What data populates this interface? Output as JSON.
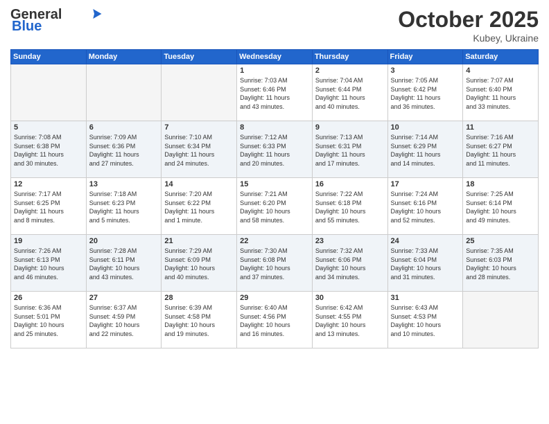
{
  "header": {
    "logo_general": "General",
    "logo_blue": "Blue",
    "month_title": "October 2025",
    "location": "Kubey, Ukraine"
  },
  "weekdays": [
    "Sunday",
    "Monday",
    "Tuesday",
    "Wednesday",
    "Thursday",
    "Friday",
    "Saturday"
  ],
  "weeks": [
    {
      "shade": false,
      "days": [
        {
          "num": "",
          "info": ""
        },
        {
          "num": "",
          "info": ""
        },
        {
          "num": "",
          "info": ""
        },
        {
          "num": "1",
          "info": "Sunrise: 7:03 AM\nSunset: 6:46 PM\nDaylight: 11 hours\nand 43 minutes."
        },
        {
          "num": "2",
          "info": "Sunrise: 7:04 AM\nSunset: 6:44 PM\nDaylight: 11 hours\nand 40 minutes."
        },
        {
          "num": "3",
          "info": "Sunrise: 7:05 AM\nSunset: 6:42 PM\nDaylight: 11 hours\nand 36 minutes."
        },
        {
          "num": "4",
          "info": "Sunrise: 7:07 AM\nSunset: 6:40 PM\nDaylight: 11 hours\nand 33 minutes."
        }
      ]
    },
    {
      "shade": true,
      "days": [
        {
          "num": "5",
          "info": "Sunrise: 7:08 AM\nSunset: 6:38 PM\nDaylight: 11 hours\nand 30 minutes."
        },
        {
          "num": "6",
          "info": "Sunrise: 7:09 AM\nSunset: 6:36 PM\nDaylight: 11 hours\nand 27 minutes."
        },
        {
          "num": "7",
          "info": "Sunrise: 7:10 AM\nSunset: 6:34 PM\nDaylight: 11 hours\nand 24 minutes."
        },
        {
          "num": "8",
          "info": "Sunrise: 7:12 AM\nSunset: 6:33 PM\nDaylight: 11 hours\nand 20 minutes."
        },
        {
          "num": "9",
          "info": "Sunrise: 7:13 AM\nSunset: 6:31 PM\nDaylight: 11 hours\nand 17 minutes."
        },
        {
          "num": "10",
          "info": "Sunrise: 7:14 AM\nSunset: 6:29 PM\nDaylight: 11 hours\nand 14 minutes."
        },
        {
          "num": "11",
          "info": "Sunrise: 7:16 AM\nSunset: 6:27 PM\nDaylight: 11 hours\nand 11 minutes."
        }
      ]
    },
    {
      "shade": false,
      "days": [
        {
          "num": "12",
          "info": "Sunrise: 7:17 AM\nSunset: 6:25 PM\nDaylight: 11 hours\nand 8 minutes."
        },
        {
          "num": "13",
          "info": "Sunrise: 7:18 AM\nSunset: 6:23 PM\nDaylight: 11 hours\nand 5 minutes."
        },
        {
          "num": "14",
          "info": "Sunrise: 7:20 AM\nSunset: 6:22 PM\nDaylight: 11 hours\nand 1 minute."
        },
        {
          "num": "15",
          "info": "Sunrise: 7:21 AM\nSunset: 6:20 PM\nDaylight: 10 hours\nand 58 minutes."
        },
        {
          "num": "16",
          "info": "Sunrise: 7:22 AM\nSunset: 6:18 PM\nDaylight: 10 hours\nand 55 minutes."
        },
        {
          "num": "17",
          "info": "Sunrise: 7:24 AM\nSunset: 6:16 PM\nDaylight: 10 hours\nand 52 minutes."
        },
        {
          "num": "18",
          "info": "Sunrise: 7:25 AM\nSunset: 6:14 PM\nDaylight: 10 hours\nand 49 minutes."
        }
      ]
    },
    {
      "shade": true,
      "days": [
        {
          "num": "19",
          "info": "Sunrise: 7:26 AM\nSunset: 6:13 PM\nDaylight: 10 hours\nand 46 minutes."
        },
        {
          "num": "20",
          "info": "Sunrise: 7:28 AM\nSunset: 6:11 PM\nDaylight: 10 hours\nand 43 minutes."
        },
        {
          "num": "21",
          "info": "Sunrise: 7:29 AM\nSunset: 6:09 PM\nDaylight: 10 hours\nand 40 minutes."
        },
        {
          "num": "22",
          "info": "Sunrise: 7:30 AM\nSunset: 6:08 PM\nDaylight: 10 hours\nand 37 minutes."
        },
        {
          "num": "23",
          "info": "Sunrise: 7:32 AM\nSunset: 6:06 PM\nDaylight: 10 hours\nand 34 minutes."
        },
        {
          "num": "24",
          "info": "Sunrise: 7:33 AM\nSunset: 6:04 PM\nDaylight: 10 hours\nand 31 minutes."
        },
        {
          "num": "25",
          "info": "Sunrise: 7:35 AM\nSunset: 6:03 PM\nDaylight: 10 hours\nand 28 minutes."
        }
      ]
    },
    {
      "shade": false,
      "days": [
        {
          "num": "26",
          "info": "Sunrise: 6:36 AM\nSunset: 5:01 PM\nDaylight: 10 hours\nand 25 minutes."
        },
        {
          "num": "27",
          "info": "Sunrise: 6:37 AM\nSunset: 4:59 PM\nDaylight: 10 hours\nand 22 minutes."
        },
        {
          "num": "28",
          "info": "Sunrise: 6:39 AM\nSunset: 4:58 PM\nDaylight: 10 hours\nand 19 minutes."
        },
        {
          "num": "29",
          "info": "Sunrise: 6:40 AM\nSunset: 4:56 PM\nDaylight: 10 hours\nand 16 minutes."
        },
        {
          "num": "30",
          "info": "Sunrise: 6:42 AM\nSunset: 4:55 PM\nDaylight: 10 hours\nand 13 minutes."
        },
        {
          "num": "31",
          "info": "Sunrise: 6:43 AM\nSunset: 4:53 PM\nDaylight: 10 hours\nand 10 minutes."
        },
        {
          "num": "",
          "info": ""
        }
      ]
    }
  ]
}
